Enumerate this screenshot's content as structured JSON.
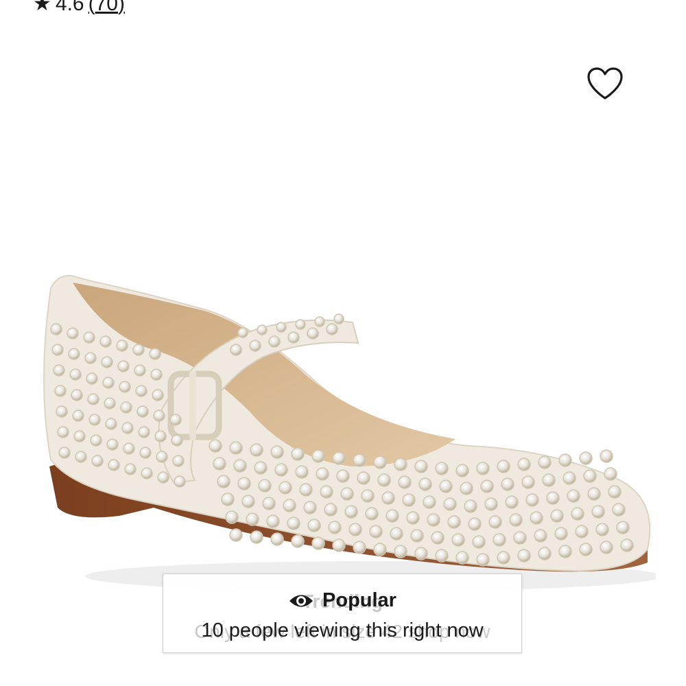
{
  "rating": {
    "star_glyph": "★",
    "value": "4.6",
    "count_open": "(",
    "count": "70",
    "count_close": ")"
  },
  "wishlist": {
    "icon": "heart-outline-icon"
  },
  "product_image": {
    "icon": "product-photo-mary-jane-flat",
    "colors": {
      "upper": "#efe9df",
      "lining": "#d4b48c",
      "sole": "#8a4a26",
      "crystal": "#e8e2d6",
      "buckle": "#d8d2c4"
    }
  },
  "popular_toast": {
    "ghost_title": "Trending",
    "ghost_subtitle": "Only a few left in size 42 shop now",
    "eye_icon": "eye-icon",
    "title": "Popular",
    "subtitle": "10 people viewing this right now"
  }
}
